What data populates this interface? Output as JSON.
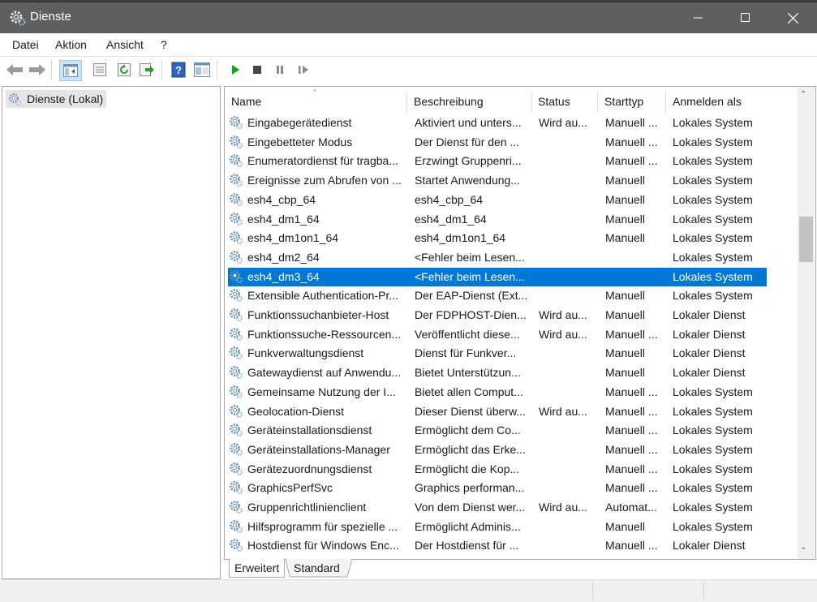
{
  "window": {
    "title": "Dienste"
  },
  "menu": [
    "Datei",
    "Aktion",
    "Ansicht",
    "?"
  ],
  "toolbar_icons": [
    "back-icon",
    "forward-icon",
    "show-tree-icon",
    "properties-icon",
    "refresh-icon",
    "export-icon",
    "help-icon",
    "console-view-icon",
    "start-service-icon",
    "stop-service-icon",
    "pause-service-icon",
    "resume-service-icon"
  ],
  "tree": {
    "root_label": "Dienste (Lokal)"
  },
  "columns": {
    "name": "Name",
    "description": "Beschreibung",
    "status": "Status",
    "startup": "Starttyp",
    "logon": "Anmelden als"
  },
  "services": [
    {
      "name": "Eingabegerätedienst",
      "description": "Aktiviert und unters...",
      "status": "Wird au...",
      "startup": "Manuell ...",
      "logon": "Lokales System"
    },
    {
      "name": "Eingebetteter Modus",
      "description": "Der Dienst für den ...",
      "status": "",
      "startup": "Manuell ...",
      "logon": "Lokales System"
    },
    {
      "name": "Enumeratordienst für tragba...",
      "description": "Erzwingt Gruppenri...",
      "status": "",
      "startup": "Manuell ...",
      "logon": "Lokales System"
    },
    {
      "name": "Ereignisse zum Abrufen von ...",
      "description": "Startet Anwendung...",
      "status": "",
      "startup": "Manuell",
      "logon": "Lokales System"
    },
    {
      "name": "esh4_cbp_64",
      "description": "esh4_cbp_64",
      "status": "",
      "startup": "Manuell",
      "logon": "Lokales System"
    },
    {
      "name": "esh4_dm1_64",
      "description": "esh4_dm1_64",
      "status": "",
      "startup": "Manuell",
      "logon": "Lokales System"
    },
    {
      "name": "esh4_dm1on1_64",
      "description": "esh4_dm1on1_64",
      "status": "",
      "startup": "Manuell",
      "logon": "Lokales System"
    },
    {
      "name": "esh4_dm2_64",
      "description": "<Fehler beim Lesen...",
      "status": "",
      "startup": "",
      "logon": "Lokales System"
    },
    {
      "name": "esh4_dm3_64",
      "description": "<Fehler beim Lesen...",
      "status": "",
      "startup": "",
      "logon": "Lokales System",
      "selected": true
    },
    {
      "name": "Extensible Authentication-Pr...",
      "description": "Der EAP-Dienst (Ext...",
      "status": "",
      "startup": "Manuell",
      "logon": "Lokales System"
    },
    {
      "name": "Funktionssuchanbieter-Host",
      "description": "Der FDPHOST-Dien...",
      "status": "Wird au...",
      "startup": "Manuell",
      "logon": "Lokaler Dienst"
    },
    {
      "name": "Funktionssuche-Ressourcen...",
      "description": "Veröffentlicht diese...",
      "status": "Wird au...",
      "startup": "Manuell ...",
      "logon": "Lokaler Dienst"
    },
    {
      "name": "Funkverwaltungsdienst",
      "description": "Dienst für Funkver...",
      "status": "",
      "startup": "Manuell",
      "logon": "Lokaler Dienst"
    },
    {
      "name": "Gatewaydienst auf Anwendu...",
      "description": "Bietet Unterstützun...",
      "status": "",
      "startup": "Manuell",
      "logon": "Lokaler Dienst"
    },
    {
      "name": "Gemeinsame Nutzung der I...",
      "description": "Bietet allen Comput...",
      "status": "",
      "startup": "Manuell ...",
      "logon": "Lokales System"
    },
    {
      "name": "Geolocation-Dienst",
      "description": "Dieser Dienst überw...",
      "status": "Wird au...",
      "startup": "Manuell ...",
      "logon": "Lokales System"
    },
    {
      "name": "Geräteinstallationsdienst",
      "description": "Ermöglicht dem Co...",
      "status": "",
      "startup": "Manuell ...",
      "logon": "Lokales System"
    },
    {
      "name": "Geräteinstallations-Manager",
      "description": "Ermöglicht das Erke...",
      "status": "",
      "startup": "Manuell ...",
      "logon": "Lokales System"
    },
    {
      "name": "Gerätezuordnungsdienst",
      "description": "Ermöglicht die Kop...",
      "status": "",
      "startup": "Manuell ...",
      "logon": "Lokales System"
    },
    {
      "name": "GraphicsPerfSvc",
      "description": "Graphics performan...",
      "status": "",
      "startup": "Manuell ...",
      "logon": "Lokales System"
    },
    {
      "name": "Gruppenrichtlinienclient",
      "description": "Von dem Dienst wer...",
      "status": "Wird au...",
      "startup": "Automat...",
      "logon": "Lokales System"
    },
    {
      "name": "Hilfsprogramm für spezielle ...",
      "description": "Ermöglicht Adminis...",
      "status": "",
      "startup": "Manuell",
      "logon": "Lokales System"
    },
    {
      "name": "Hostdienst für Windows Enc...",
      "description": "Der Hostdienst für ...",
      "status": "",
      "startup": "Manuell ...",
      "logon": "Lokaler Dienst"
    }
  ],
  "tabs": [
    "Erweitert",
    "Standard"
  ],
  "colors": {
    "titlebar": "#5f5f5f",
    "selection": "#0078d7",
    "play_green": "#1aa31a"
  }
}
